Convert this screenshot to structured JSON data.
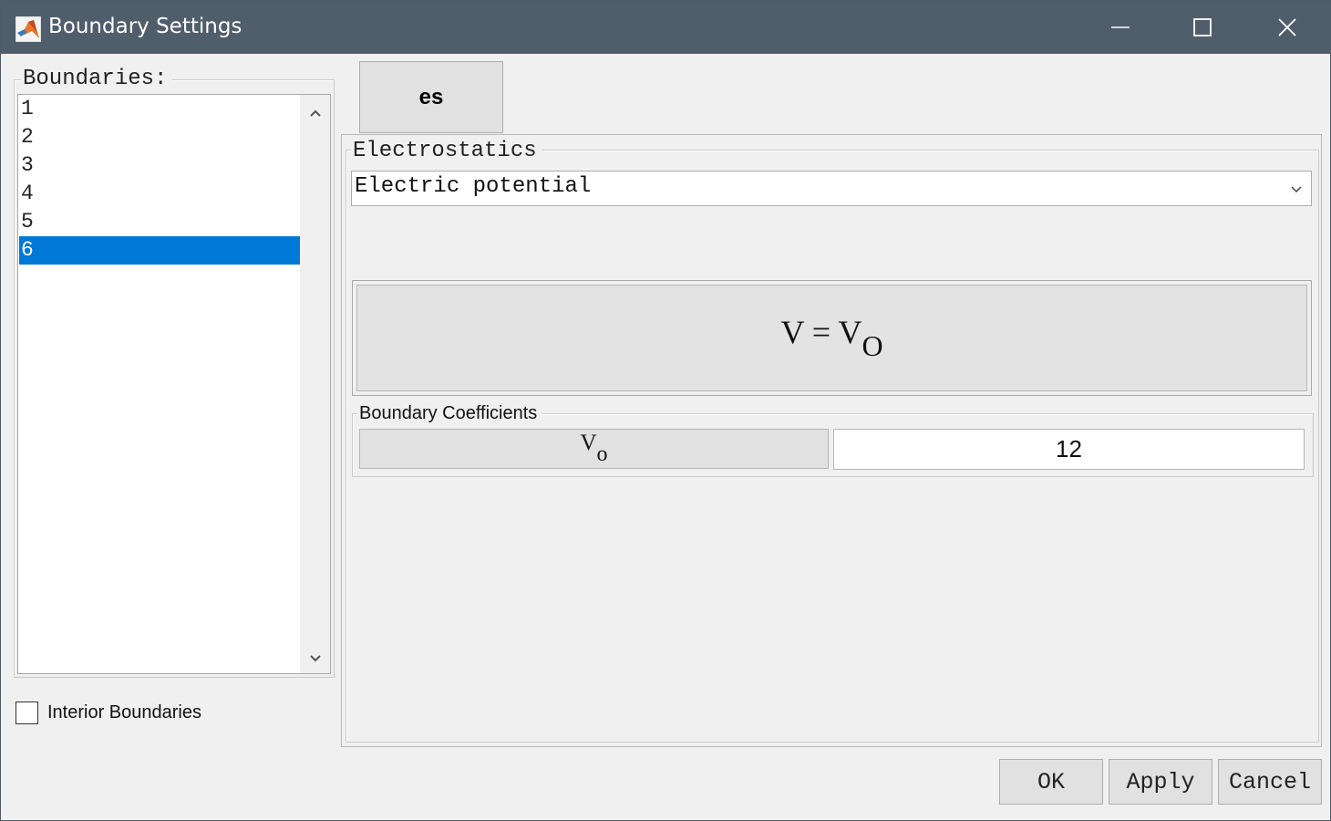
{
  "window": {
    "title": "Boundary Settings",
    "controls": {
      "minimize": "minimize-icon",
      "maximize": "maximize-icon",
      "close": "close-icon"
    }
  },
  "boundaries": {
    "label": "Boundaries:",
    "items": [
      "1",
      "2",
      "3",
      "4",
      "5",
      "6"
    ],
    "selected": "6"
  },
  "interior": {
    "label": "Interior Boundaries",
    "checked": false
  },
  "tab": {
    "label": "es"
  },
  "physics": {
    "group_label": "Electrostatics",
    "condition": "Electric potential",
    "equation_lhs": "V = V",
    "equation_sub": "O"
  },
  "coefficients": {
    "group_label": "Boundary Coefficients",
    "symbol": "V",
    "symbol_sub": "o",
    "value": "12"
  },
  "buttons": {
    "ok": "OK",
    "apply": "Apply",
    "cancel": "Cancel"
  },
  "colors": {
    "titlebar": "#505d6b",
    "selection": "#0078d7",
    "background": "#f0f0f0"
  }
}
